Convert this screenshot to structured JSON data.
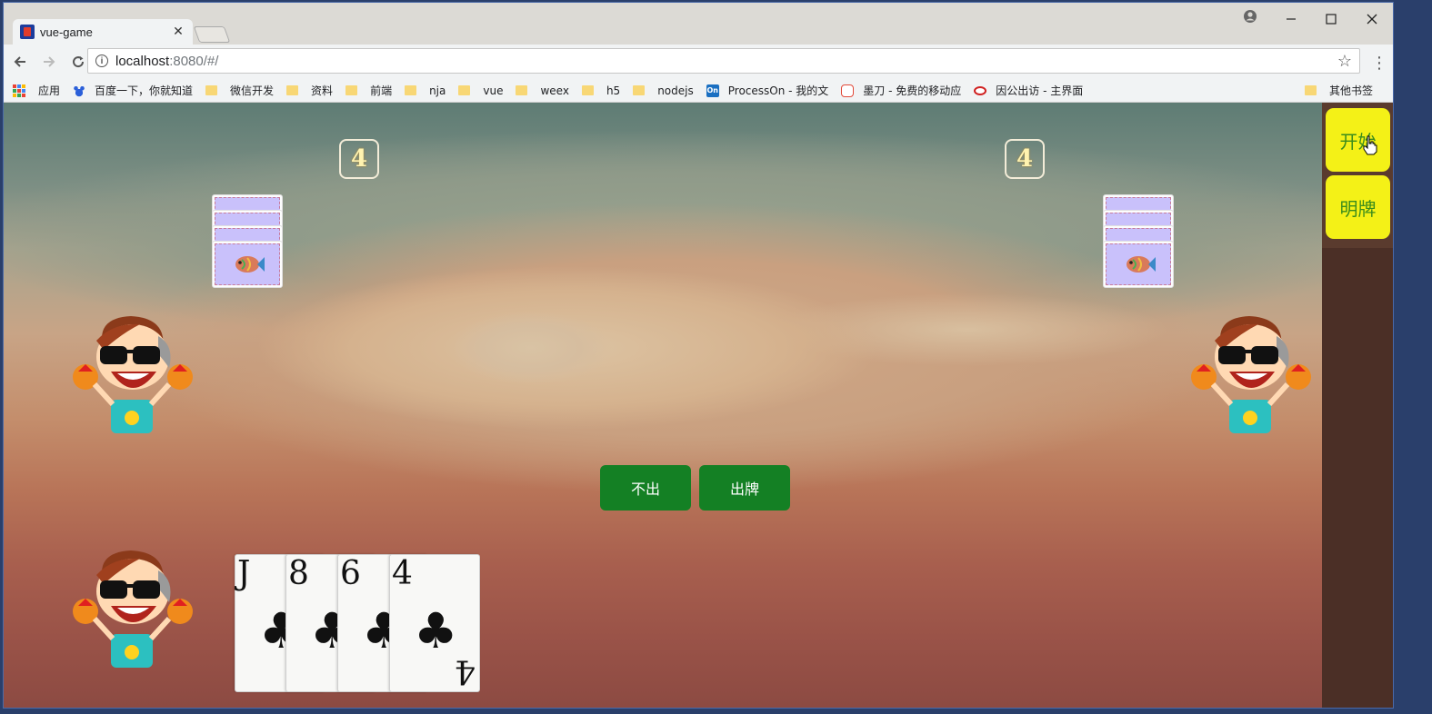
{
  "browser": {
    "tab_title": "vue-game",
    "tab_close": "✕",
    "url_host": "localhost",
    "url_path": ":8080/#/",
    "bookmarks": [
      {
        "label": "应用",
        "icon": "apps-grid-icon"
      },
      {
        "label": "百度一下，你就知道",
        "icon": "baidu-paw-icon"
      },
      {
        "label": "微信开发",
        "icon": "folder-icon"
      },
      {
        "label": "资料",
        "icon": "folder-icon"
      },
      {
        "label": "前端",
        "icon": "folder-icon"
      },
      {
        "label": "nja",
        "icon": "folder-icon"
      },
      {
        "label": "vue",
        "icon": "folder-icon"
      },
      {
        "label": "weex",
        "icon": "folder-icon"
      },
      {
        "label": "h5",
        "icon": "folder-icon"
      },
      {
        "label": "nodejs",
        "icon": "folder-icon"
      },
      {
        "label": "ProcessOn - 我的文",
        "icon": "processon-icon"
      },
      {
        "label": "墨刀 - 免费的移动应",
        "icon": "modao-icon"
      },
      {
        "label": "因公出访 - 主界面",
        "icon": "eye-logo-icon"
      }
    ],
    "other_bookmarks": "其他书签"
  },
  "game": {
    "left_opponent": {
      "count": "4",
      "backs": 4
    },
    "right_opponent": {
      "count": "4",
      "backs": 4
    },
    "actions": {
      "pass": "不出",
      "play": "出牌"
    },
    "hand": [
      {
        "rank": "J",
        "suit": "♣"
      },
      {
        "rank": "8",
        "suit": "♣"
      },
      {
        "rank": "6",
        "suit": "♣"
      },
      {
        "rank": "4",
        "suit": "♣"
      }
    ],
    "last_card_bottom_rank": "4"
  },
  "sidebar": {
    "start_label": "开始",
    "reveal_label": "明牌",
    "button_color": "#f4f117",
    "text_color": "#3a8c1c"
  },
  "colors": {
    "action_button": "#148024",
    "card_back": "#c9c1fb"
  }
}
